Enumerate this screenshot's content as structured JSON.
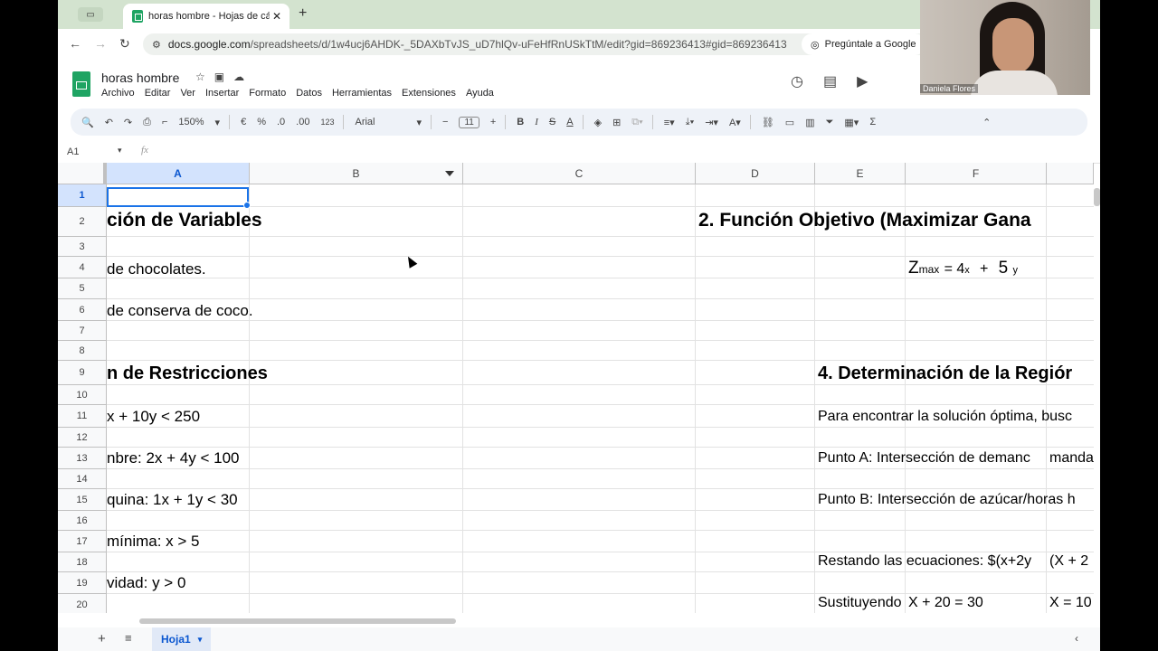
{
  "browser": {
    "tab_title": "horas hombre - Hojas de cálc",
    "url_host": "docs.google.com",
    "url_path": "/spreadsheets/d/1w4ucj6AHDK-_5DAXbTvJS_uD7hlQv-uFeHfRnUSkTtM/edit?gid=869236413#gid=869236413",
    "ask_label": "Pregúntale a Google"
  },
  "doc": {
    "title": "horas hombre",
    "menus": [
      "Archivo",
      "Editar",
      "Ver",
      "Insertar",
      "Formato",
      "Datos",
      "Herramientas",
      "Extensiones",
      "Ayuda"
    ]
  },
  "toolbar": {
    "zoom": "150%",
    "currency": "€",
    "percent": "%",
    "dec_minus": ".0",
    "dec_plus": ".00",
    "number_fmt": "123",
    "font": "Arial",
    "font_size": "11",
    "bold": "B",
    "italic": "I",
    "strike": "S",
    "text_color": "A"
  },
  "formula": {
    "name_box": "A1",
    "fx": "fx"
  },
  "columns": [
    "A",
    "B",
    "C",
    "D",
    "E",
    "F"
  ],
  "rows": [
    "1",
    "2",
    "3",
    "4",
    "5",
    "6",
    "7",
    "8",
    "9",
    "10",
    "11",
    "12",
    "13",
    "14",
    "15",
    "16",
    "17",
    "18",
    "19",
    "20"
  ],
  "cells": {
    "a2": "ción de Variables",
    "d2": "2. Función Objetivo (Maximizar Gana",
    "a4": "de chocolates.",
    "e4_z": "Z",
    "e4_max": "max",
    "e4_eq": "= 4",
    "e4_x": "x",
    "e4_plus": "+",
    "e4_5": "5",
    "e4_y": "y",
    "a6": "de conserva de coco.",
    "a9": "n de Restricciones",
    "e9": "4. Determinación de la Regiór",
    "a11": "x + 10y  <  250",
    "e11": "Para encontrar la solución óptima, busc",
    "a13": "nbre: 2x + 4y < 100",
    "e13": "Punto A: Intersección de demanc",
    "f13": "manda",
    "a15": "quina: 1x + 1y  < 30",
    "e15": "Punto B: Intersección de azúcar/horas h",
    "a17": " mínima: x > 5",
    "e18": "Restando las ecuaciones: $(x+2y",
    "f18": "(X + 2",
    "a19": "vidad: y > 0",
    "e20": "Sustituyendo",
    "e20b": "X + 20 = 30",
    "f20": "X = 10"
  },
  "sheet": {
    "tab": "Hoja1"
  },
  "webcam": {
    "name": "Daniela Flores"
  }
}
